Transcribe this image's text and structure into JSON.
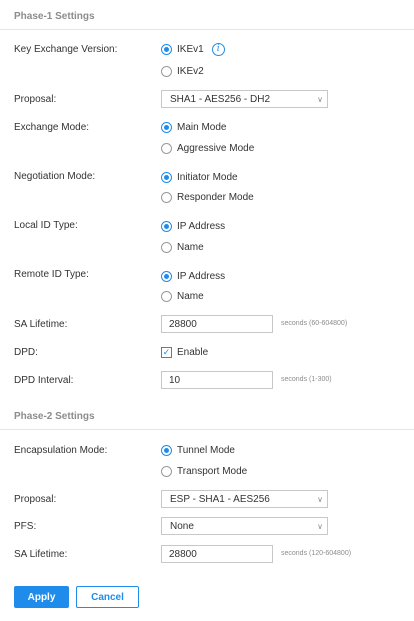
{
  "phase1": {
    "title": "Phase-1 Settings",
    "key_exchange": {
      "label": "Key Exchange Version:",
      "options": [
        "IKEv1",
        "IKEv2"
      ],
      "selected": "IKEv1"
    },
    "proposal": {
      "label": "Proposal:",
      "value": "SHA1 - AES256 - DH2"
    },
    "exchange_mode": {
      "label": "Exchange Mode:",
      "options": [
        "Main Mode",
        "Aggressive Mode"
      ],
      "selected": "Main Mode"
    },
    "negotiation_mode": {
      "label": "Negotiation Mode:",
      "options": [
        "Initiator Mode",
        "Responder Mode"
      ],
      "selected": "Initiator Mode"
    },
    "local_id_type": {
      "label": "Local ID Type:",
      "options": [
        "IP Address",
        "Name"
      ],
      "selected": "IP Address"
    },
    "remote_id_type": {
      "label": "Remote ID Type:",
      "options": [
        "IP Address",
        "Name"
      ],
      "selected": "IP Address"
    },
    "sa_lifetime": {
      "label": "SA Lifetime:",
      "value": "28800",
      "hint": "seconds (60-604800)"
    },
    "dpd": {
      "label": "DPD:",
      "option": "Enable",
      "checked": true
    },
    "dpd_interval": {
      "label": "DPD Interval:",
      "value": "10",
      "hint": "seconds (1-300)"
    }
  },
  "phase2": {
    "title": "Phase-2 Settings",
    "encapsulation_mode": {
      "label": "Encapsulation Mode:",
      "options": [
        "Tunnel Mode",
        "Transport Mode"
      ],
      "selected": "Tunnel Mode"
    },
    "proposal": {
      "label": "Proposal:",
      "value": "ESP - SHA1 - AES256"
    },
    "pfs": {
      "label": "PFS:",
      "value": "None"
    },
    "sa_lifetime": {
      "label": "SA Lifetime:",
      "value": "28800",
      "hint": "seconds (120-604800)"
    }
  },
  "buttons": {
    "apply": "Apply",
    "cancel": "Cancel"
  },
  "colors": {
    "accent": "#1f8ceb",
    "section_title": "#8c8c8c",
    "border": "#c8c8c8"
  },
  "icons": {
    "info": "info-icon",
    "select_arrow": "chevron-down-icon",
    "check": "check-icon"
  }
}
